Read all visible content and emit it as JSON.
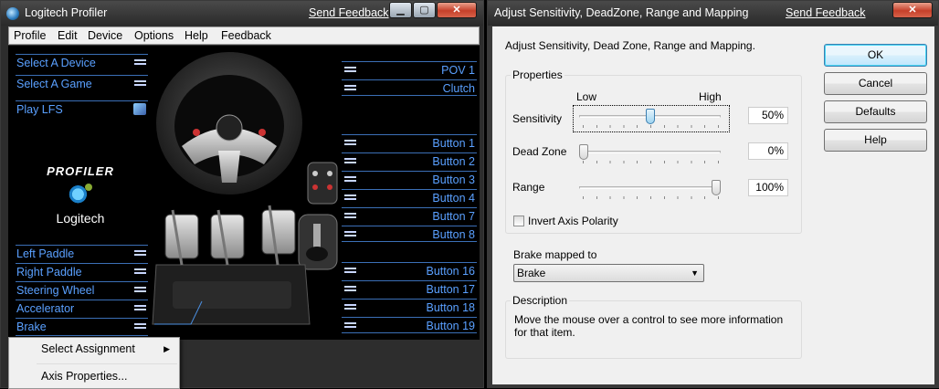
{
  "profiler": {
    "title": "Logitech Profiler",
    "send_feedback": "Send Feedback",
    "menu": [
      "Profile",
      "Edit",
      "Device",
      "Options",
      "Help",
      "Feedback"
    ],
    "left_items": {
      "select_device": "Select A Device",
      "select_game": "Select A Game",
      "play_lfs": "Play LFS",
      "left_paddle": "Left Paddle",
      "right_paddle": "Right Paddle",
      "steering_wheel": "Steering Wheel",
      "accelerator": "Accelerator",
      "brake": "Brake"
    },
    "right_items": [
      "POV 1",
      "Clutch",
      "Button 1",
      "Button 2",
      "Button 3",
      "Button 4",
      "Button 7",
      "Button 8",
      "Button 16",
      "Button 17",
      "Button 18",
      "Button 19"
    ],
    "logo": {
      "word": "PROFILER",
      "brand": "Logitech"
    },
    "context_menu": {
      "select_assignment": "Select Assignment",
      "axis_properties": "Axis Properties..."
    }
  },
  "adjust": {
    "title": "Adjust Sensitivity, DeadZone, Range and Mapping",
    "send_feedback": "Send Feedback",
    "intro": "Adjust Sensitivity, Dead Zone, Range and Mapping.",
    "properties": {
      "title": "Properties",
      "low": "Low",
      "high": "High",
      "sensitivity_label": "Sensitivity",
      "sensitivity_value": "50%",
      "sensitivity_level": 0.5,
      "deadzone_label": "Dead Zone",
      "deadzone_value": "0%",
      "deadzone_level": 0.0,
      "range_label": "Range",
      "range_value": "100%",
      "range_level": 1.0,
      "invert_label": "Invert Axis Polarity",
      "invert_checked": false
    },
    "mapping": {
      "title": "Brake mapped to",
      "selected": "Brake"
    },
    "description": {
      "title": "Description",
      "text": "Move the mouse over a control to see more information for that item."
    },
    "buttons": {
      "ok": "OK",
      "cancel": "Cancel",
      "defaults": "Defaults",
      "help": "Help"
    }
  },
  "colors": {
    "list_text": "#5aa0ff",
    "list_line": "#3b6fb6",
    "ok_border": "#3c7fb1"
  }
}
